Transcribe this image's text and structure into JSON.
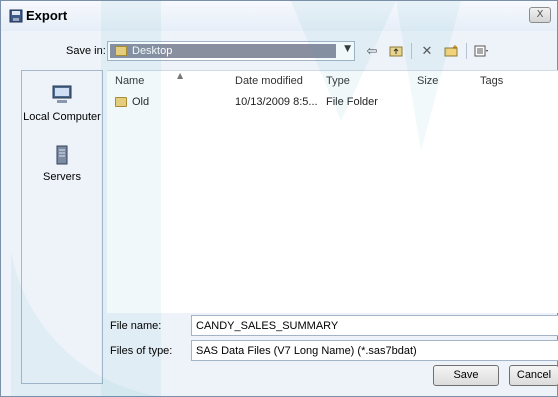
{
  "window": {
    "title": "Export",
    "close_label": "X"
  },
  "savein": {
    "label": "Save in:",
    "value": "Desktop"
  },
  "toolbar": {
    "icons": [
      "back-icon",
      "up-folder-icon",
      "delete-icon",
      "new-folder-icon",
      "views-icon"
    ]
  },
  "places": {
    "items": [
      {
        "label": "Local Computer",
        "icon": "computer-icon"
      },
      {
        "label": "Servers",
        "icon": "server-icon"
      }
    ]
  },
  "filelist": {
    "columns": {
      "name": "Name",
      "date": "Date modified",
      "type": "Type",
      "size": "Size",
      "tags": "Tags"
    },
    "rows": [
      {
        "name": "Old",
        "date": "10/13/2009 8:5...",
        "type": "File Folder",
        "size": "",
        "tags": ""
      }
    ]
  },
  "form": {
    "filename_label": "File name:",
    "filename_value": "CANDY_SALES_SUMMARY",
    "filetype_label": "Files of type:",
    "filetype_value": "SAS Data Files (V7 Long Name) (*.sas7bdat)"
  },
  "buttons": {
    "save": "Save",
    "cancel": "Cancel"
  },
  "colors": {
    "dialog_bg": "#eef3fa",
    "overlay": "#3aa6b5",
    "selection": "#8a8fa0"
  }
}
